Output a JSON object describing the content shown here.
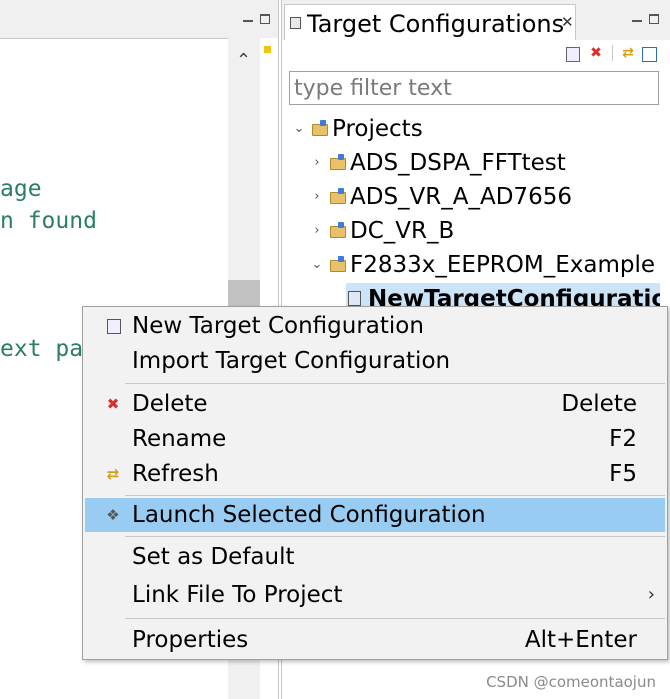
{
  "editor": {
    "code_lines": [
      "age",
      "n found",
      "ext pa"
    ]
  },
  "target_view": {
    "title": "Target Configurations",
    "filter_placeholder": "type filter text",
    "tree": {
      "root_label": "Projects",
      "projects": [
        "ADS_DSPA_FFTtest",
        "ADS_VR_A_AD7656",
        "DC_VR_B",
        "F2833x_EEPROM_Example"
      ],
      "selected_file": "NewTargetConfiguratio"
    }
  },
  "context_menu": {
    "items": [
      {
        "label": "New Target Configuration",
        "shortcut": "",
        "icon": "new-config-icon"
      },
      {
        "label": "Import Target Configuration",
        "shortcut": ""
      },
      {
        "label": "Delete",
        "shortcut": "Delete",
        "icon": "delete-x-icon"
      },
      {
        "label": "Rename",
        "shortcut": "F2"
      },
      {
        "label": "Refresh",
        "shortcut": "F5",
        "icon": "refresh-icon"
      },
      {
        "label": "Launch Selected Configuration",
        "shortcut": "",
        "icon": "launch-icon"
      },
      {
        "label": "Set as Default",
        "shortcut": ""
      },
      {
        "label": "Link File To Project",
        "shortcut": ""
      },
      {
        "label": "Properties",
        "shortcut": "Alt+Enter"
      }
    ],
    "highlight_color": "#99ccf3"
  },
  "watermark": "CSDN @comeontaojun",
  "colors": {
    "code_text": "#2a7f62",
    "selection": "#cce4f7",
    "delete_red": "#d9302c"
  }
}
